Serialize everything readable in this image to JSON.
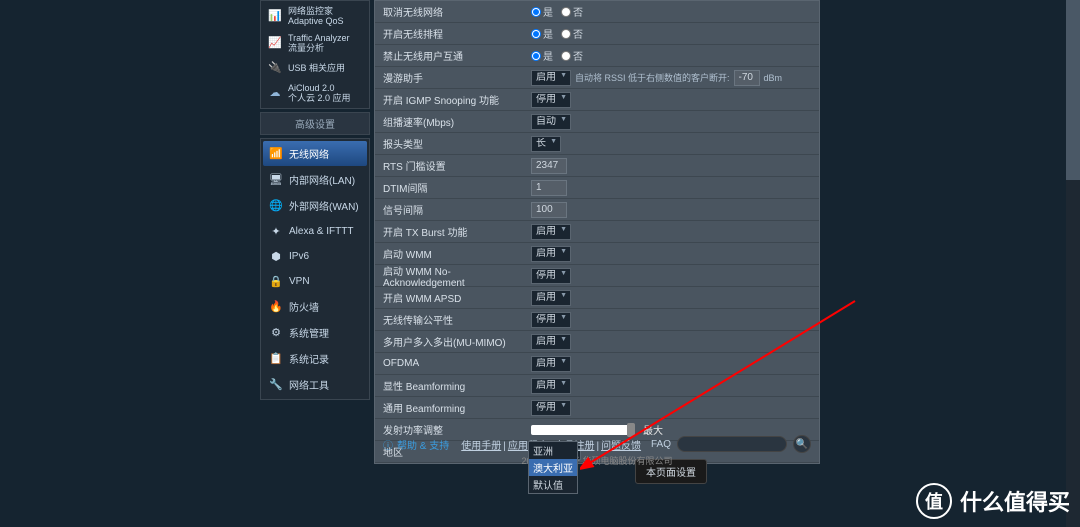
{
  "top_menu": [
    {
      "icon": "📊",
      "label": "网络监控家 Adaptive QoS"
    },
    {
      "icon": "📈",
      "label": "Traffic Analyzer\n流量分析"
    },
    {
      "icon": "🔌",
      "label": "USB 相关应用"
    },
    {
      "icon": "☁",
      "label": "AiCloud 2.0\n个人云 2.0 应用"
    }
  ],
  "adv_title": "高级设置",
  "nav": [
    {
      "icon": "📶",
      "label": "无线网络",
      "active": true
    },
    {
      "icon": "🖥",
      "label": "内部网络(LAN)"
    },
    {
      "icon": "🌐",
      "label": "外部网络(WAN)"
    },
    {
      "icon": "✦",
      "label": "Alexa & IFTTT"
    },
    {
      "icon": "⬢",
      "label": "IPv6"
    },
    {
      "icon": "🔒",
      "label": "VPN"
    },
    {
      "icon": "🔥",
      "label": "防火墙"
    },
    {
      "icon": "⚙",
      "label": "系统管理"
    },
    {
      "icon": "📋",
      "label": "系统记录"
    },
    {
      "icon": "🔧",
      "label": "网络工具"
    }
  ],
  "rows": [
    {
      "label": "取消无线网络",
      "type": "radio",
      "opts": [
        "是",
        "否"
      ],
      "val": "是"
    },
    {
      "label": "开启无线排程",
      "type": "radio",
      "opts": [
        "是",
        "否"
      ],
      "val": "是"
    },
    {
      "label": "禁止无线用户互通",
      "type": "radio",
      "opts": [
        "是",
        "否"
      ],
      "val": "是"
    },
    {
      "label": "漫游助手",
      "type": "roam",
      "sel": "启用",
      "hint": "自动将 RSSI 低于右侧数值的客户断开:",
      "num": "-70",
      "unit": "dBm"
    },
    {
      "label": "开启 IGMP Snooping 功能",
      "type": "select",
      "val": "停用"
    },
    {
      "label": "组播速率(Mbps)",
      "type": "select",
      "val": "自动"
    },
    {
      "label": "报头类型",
      "type": "select",
      "val": "长"
    },
    {
      "label": "RTS 门槛设置",
      "type": "input",
      "val": "2347"
    },
    {
      "label": "DTIM间隔",
      "type": "input",
      "val": "1"
    },
    {
      "label": "信号间隔",
      "type": "input",
      "val": "100"
    },
    {
      "label": "开启 TX Burst 功能",
      "type": "select",
      "val": "启用"
    },
    {
      "label": "启动 WMM",
      "type": "select",
      "val": "启用"
    },
    {
      "label": "启动 WMM No-Acknowledgement",
      "type": "select",
      "val": "停用"
    },
    {
      "label": "开启 WMM APSD",
      "type": "select",
      "val": "启用"
    },
    {
      "label": "无线传输公平性",
      "type": "select",
      "val": "停用"
    },
    {
      "label": "多用户多入多出(MU-MIMO)",
      "type": "select",
      "val": "启用"
    },
    {
      "label": "OFDMA",
      "type": "select",
      "val": "启用"
    },
    {
      "label": "显性 Beamforming",
      "type": "select",
      "val": "启用"
    },
    {
      "label": "通用 Beamforming",
      "type": "select",
      "val": "停用"
    },
    {
      "label": "发射功率调整",
      "type": "slider",
      "txt": "最大"
    },
    {
      "label": "地区",
      "type": "region",
      "val": "默认值"
    }
  ],
  "region_opts": [
    "亚洲",
    "澳大利亚",
    "默认值"
  ],
  "apply": "本页面设置",
  "footer": {
    "help": "帮助 & 支持",
    "links": [
      "使用手册",
      "应用程序",
      "产品注册",
      "问题反馈"
    ],
    "faq": "FAQ"
  },
  "copyright": "2019 版权属于 华硕电脑股份有限公司",
  "watermark": {
    "badge": "值",
    "text": "什么值得买"
  }
}
